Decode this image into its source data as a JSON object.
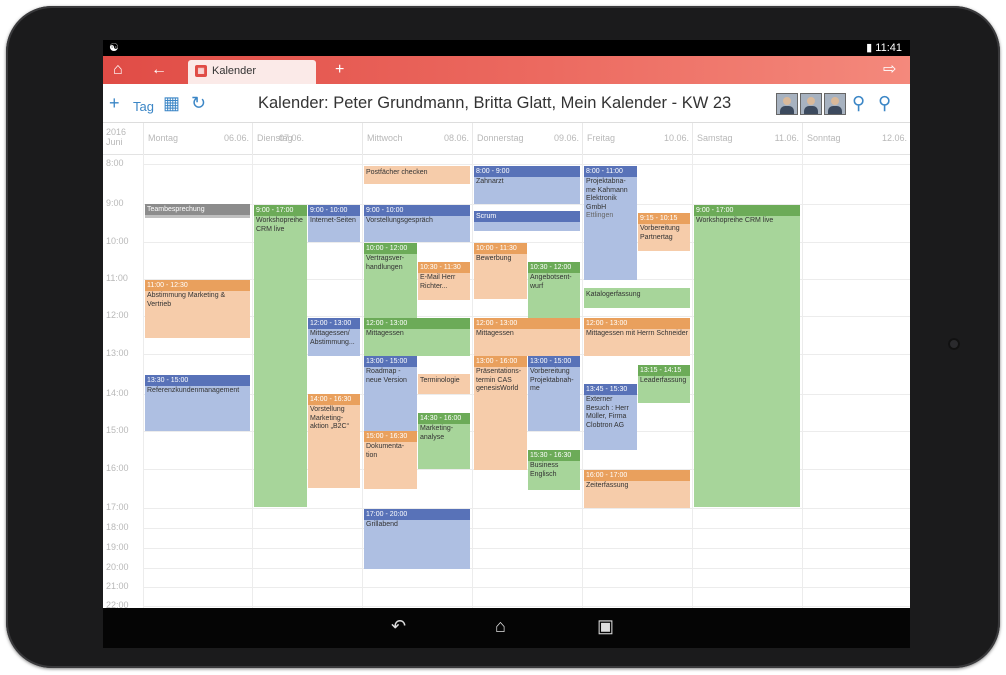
{
  "status_bar": {
    "left_icon": "lightbulb-icon",
    "time": "11:41"
  },
  "app_bar": {
    "tab_label": "Kalender",
    "tab_icon": "calendar-icon",
    "add_tab": "+"
  },
  "toolbar": {
    "add": "+",
    "view_label": "Tag",
    "title": "Kalender: Peter Grundmann, Britta Glatt, Mein Kalender - KW 23"
  },
  "header": {
    "year": "2016",
    "month": "Juni",
    "days": [
      {
        "name": "Montag",
        "date": "06.06."
      },
      {
        "name": "Dienstag",
        "date": "07.06."
      },
      {
        "name": "Mittwoch",
        "date": "08.06."
      },
      {
        "name": "Donnerstag",
        "date": "09.06."
      },
      {
        "name": "Freitag",
        "date": "10.06."
      },
      {
        "name": "Samstag",
        "date": "11.06."
      },
      {
        "name": "Sonntag",
        "date": "12.06."
      }
    ]
  },
  "hours": [
    "8:00",
    "9:00",
    "10:00",
    "11:00",
    "12:00",
    "13:00",
    "14:00",
    "15:00",
    "16:00",
    "17:00",
    "18:00",
    "19:00",
    "20:00",
    "21:00",
    "22:00"
  ],
  "events": {
    "mo_team": {
      "time": "",
      "title": "Teambesprechung"
    },
    "mo_abstimmung": {
      "time": "11:00 - 12:30",
      "title": "Abstimmung Marketing & Vertrieb"
    },
    "mo_referenz": {
      "time": "13:30 - 15:00",
      "title": "Referenzkundenmanagement"
    },
    "di_workshop": {
      "time": "9:00 - 17:00",
      "title": "Workshopreihe CRM live"
    },
    "di_internet": {
      "time": "9:00 - 10:00",
      "title": "Internet-Seiten"
    },
    "di_mittag": {
      "time": "12:00 - 13:00",
      "title": "Mittagessen/ Abstimmung..."
    },
    "di_vorstellung": {
      "time": "14:00 - 16:30",
      "title": "Vorstellung Marketing-aktion „B2C“"
    },
    "mi_postfach": {
      "time": "",
      "title": "Postfächer checken"
    },
    "mi_vorstellung": {
      "time": "9:00 - 10:00",
      "title": "Vorstellungsgespräch"
    },
    "mi_vertrag": {
      "time": "10:00 - 12:00",
      "title": "Vertragsver-handlungen"
    },
    "mi_email": {
      "time": "10:30 - 11:30",
      "title": "E-Mail Herr Richter..."
    },
    "mi_mittag": {
      "time": "12:00 - 13:00",
      "title": "Mittagessen"
    },
    "mi_roadmap": {
      "time": "13:00 - 15:00",
      "title": "Roadmap - neue Version"
    },
    "mi_terminologie": {
      "time": "",
      "title": "Terminologie"
    },
    "mi_marketing": {
      "time": "14:30 - 16:00",
      "title": "Marketing-analyse"
    },
    "mi_doku": {
      "time": "15:00 - 16:30",
      "title": "Dokumenta-tion"
    },
    "mi_grill": {
      "time": "17:00 - 20:00",
      "title": "Grillabend"
    },
    "do_zahnarzt": {
      "time": "8:00 - 9:00",
      "title": "Zahnarzt"
    },
    "do_scrum": {
      "time": "",
      "title": "Scrum"
    },
    "do_bewerbung": {
      "time": "10:00 - 11:30",
      "title": "Bewerbung"
    },
    "do_angebot": {
      "time": "10:30 - 12:00",
      "title": "Angebotsent-wurf"
    },
    "do_mittag": {
      "time": "12:00 - 13:00",
      "title": "Mittagessen"
    },
    "do_praesentation": {
      "time": "13:00 - 16:00",
      "title": "Präsentations-termin CAS genesisWorld"
    },
    "do_vorbereitung": {
      "time": "13:00 - 15:00",
      "title": "Vorbereitung Projektabnah-me"
    },
    "do_englisch": {
      "time": "15:30 - 16:30",
      "title": "Business Englisch"
    },
    "fr_projekt": {
      "time": "8:00 - 11:00",
      "title": "Projektabna-me Kahmann Elektronik GmbH",
      "sub": "Ettlingen"
    },
    "fr_partner": {
      "time": "9:15 - 10:15",
      "title": "Vorbereitung Partnertag"
    },
    "fr_katalog": {
      "time": "",
      "title": "Katalogerfassung"
    },
    "fr_mittag": {
      "time": "12:00 - 13:00",
      "title": "Mittagessen mit Herrn Schneider"
    },
    "fr_leader": {
      "time": "13:15 - 14:15",
      "title": "Leaderfassung"
    },
    "fr_extern": {
      "time": "13:45 - 15:30",
      "title": "Externer Besuch : Herr Müller, Firma Clobtron AG"
    },
    "fr_zeit": {
      "time": "16:00 - 17:00",
      "title": "Zeiterfassung"
    },
    "sa_workshop": {
      "time": "9:00 - 17:00",
      "title": "Workshopreihe CRM live"
    }
  },
  "colors": {
    "accent": "#e04c46",
    "blue": "#5872b8",
    "orange": "#e9a05d",
    "green": "#6cab58"
  },
  "nav": {
    "back": "back-icon",
    "home": "home-icon",
    "recents": "recents-icon"
  }
}
